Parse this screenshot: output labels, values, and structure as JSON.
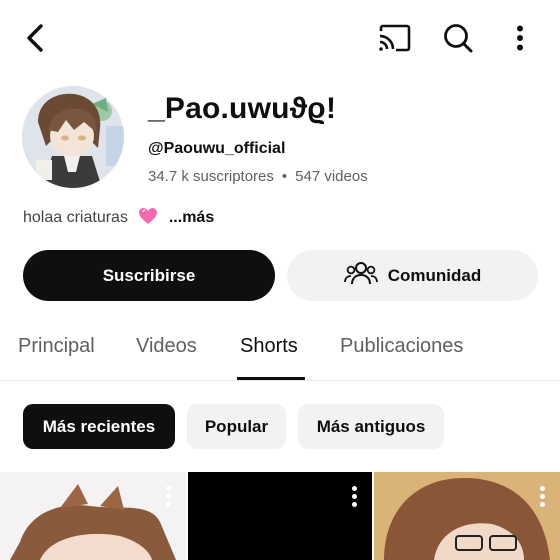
{
  "channel": {
    "name": "_Pao.uwuϑϱ!",
    "handle": "@Paouwu_official",
    "subscribers": "34.7 k suscriptores",
    "separator": "•",
    "videos": "547 videos",
    "description": "holaa criaturas",
    "more_label": "...más"
  },
  "buttons": {
    "subscribe": "Suscribirse",
    "community": "Comunidad"
  },
  "tabs": [
    {
      "label": "Principal"
    },
    {
      "label": "Videos"
    },
    {
      "label": "Shorts",
      "active": true
    },
    {
      "label": "Publicaciones"
    }
  ],
  "chips": [
    {
      "label": "Más recientes",
      "active": true
    },
    {
      "label": "Popular"
    },
    {
      "label": "Más antiguos"
    }
  ],
  "icons": {
    "back": "back-arrow-icon",
    "cast": "cast-icon",
    "search": "search-icon",
    "more": "more-vertical-icon",
    "community": "people-icon",
    "heart": "pink-heart-icon"
  },
  "colors": {
    "accent_dark": "#0f0f0f",
    "chip_bg": "#f2f2f2",
    "secondary_text": "#606060",
    "heart": "#f06ab0"
  }
}
